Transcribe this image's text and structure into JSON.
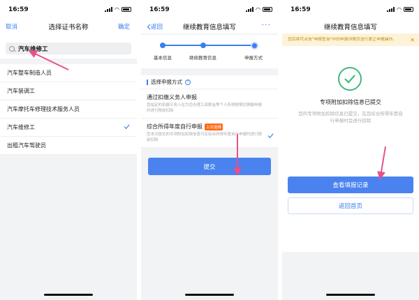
{
  "status": {
    "time": "16:59"
  },
  "screen1": {
    "nav": {
      "cancel": "取消",
      "title": "选择证书名称",
      "confirm": "确定"
    },
    "search_value": "汽车维修工",
    "results": [
      "汽车整车制造人员",
      "汽车装调工",
      "汽车摩托车修理技术服务人员",
      "汽车维修工",
      "出租汽车驾驶员"
    ],
    "selected_index": 3
  },
  "screen2": {
    "nav": {
      "back": "返回",
      "title": "继续教育信息填写",
      "more": "···"
    },
    "steps": [
      "基本信息",
      "继续教育信息",
      "申报方式"
    ],
    "current_step": 3,
    "section_title": "选择申报方式",
    "options": [
      {
        "title": "通过扣缴义务人申报",
        "desc": "您指定的扣缴义务人在为您办理工资薪金等个人所得税预扣预缴申报时进行税前扣除",
        "badge": "",
        "selected": false
      },
      {
        "title": "综合所得年度自行申报",
        "desc": "您本次提交的专项附加扣除信息可在综合所得年度自行申报时进行税前扣除",
        "badge": "上次选择",
        "selected": true
      }
    ],
    "submit_label": "提交"
  },
  "screen3": {
    "nav": {
      "title": "继续教育信息填写"
    },
    "notice": "您后续可点击\"申报查询\"中的申报详情页进行更正申报操作。",
    "success_title": "专项附加扣除信息已提交",
    "success_desc": "您的专项附加扣除信息已提交，在您综合所得年度自行申报时会进行扣除",
    "primary_button": "查看填报记录",
    "secondary_button": "返回首页"
  },
  "colors": {
    "accent": "#3b7ef0",
    "arrow": "#e8508a",
    "success": "#3dbb7a",
    "badge": "#ff6b1a"
  }
}
